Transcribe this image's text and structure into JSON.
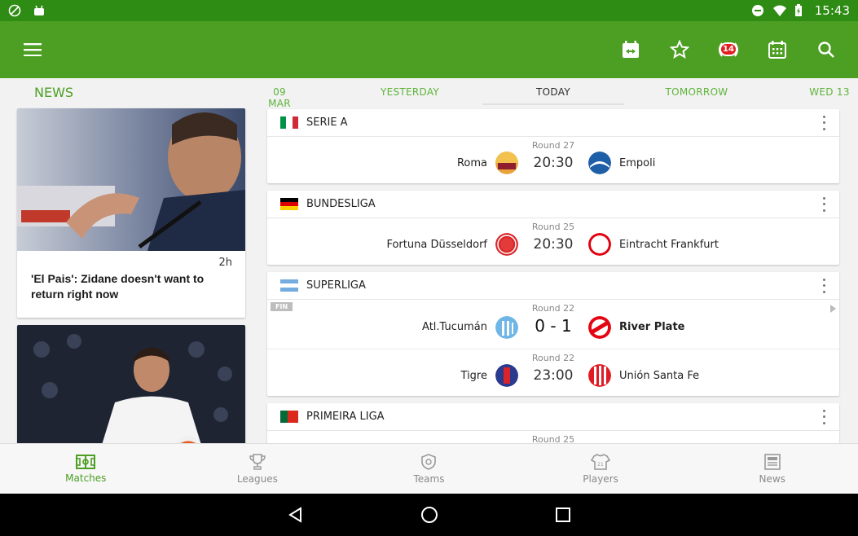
{
  "status_bar": {
    "time": "15:43"
  },
  "app_bar": {
    "live_count": "14"
  },
  "news": {
    "title": "NEWS",
    "items": [
      {
        "time": "2h",
        "headline": "'El Pais': Zidane doesn't want to return right now"
      }
    ]
  },
  "date_tabs": [
    {
      "label": "09 MAR",
      "active": false
    },
    {
      "label": "YESTERDAY",
      "active": false
    },
    {
      "label": "TODAY",
      "active": true
    },
    {
      "label": "TOMORROW",
      "active": false
    },
    {
      "label": "WED 13",
      "active": false
    }
  ],
  "leagues": [
    {
      "name": "SERIE A",
      "flag": "italy",
      "matches": [
        {
          "round": "Round 27",
          "home": "Roma",
          "away": "Empoli",
          "center": "20:30",
          "finished": false,
          "home_color": "#e8a33a",
          "away_color": "#1f5fa8"
        }
      ]
    },
    {
      "name": "BUNDESLIGA",
      "flag": "germany",
      "matches": [
        {
          "round": "Round 25",
          "home": "Fortuna Düsseldorf",
          "away": "Eintracht Frankfurt",
          "center": "20:30",
          "finished": false,
          "home_color": "#d8282a",
          "away_color": "#e1000f"
        }
      ]
    },
    {
      "name": "SUPERLIGA",
      "flag": "argentina",
      "matches": [
        {
          "round": "Round 22",
          "home": "Atl.Tucumán",
          "away": "River Plate",
          "center": "0 - 1",
          "finished": true,
          "fin_label": "FIN",
          "home_color": "#6fb6e6",
          "away_color": "#e30613"
        },
        {
          "round": "Round 22",
          "home": "Tigre",
          "away": "Unión Santa Fe",
          "center": "23:00",
          "finished": false,
          "home_color": "#2a3a8f",
          "away_color": "#e01b24"
        }
      ]
    },
    {
      "name": "PRIMEIRA LIGA",
      "flag": "portugal",
      "matches": [
        {
          "round": "Round 25",
          "home": "",
          "away": "",
          "center": "",
          "finished": false
        }
      ]
    }
  ],
  "bottom_nav": [
    {
      "label": "Matches",
      "icon": "pitch-icon",
      "active": true
    },
    {
      "label": "Leagues",
      "icon": "trophy-icon",
      "active": false
    },
    {
      "label": "Teams",
      "icon": "shield-icon",
      "active": false
    },
    {
      "label": "Players",
      "icon": "jersey-icon",
      "active": false
    },
    {
      "label": "News",
      "icon": "newspaper-icon",
      "active": false
    }
  ],
  "colors": {
    "primary": "#4c9f22",
    "status": "#2e8b13",
    "accent_tab": "#5fb33a"
  }
}
